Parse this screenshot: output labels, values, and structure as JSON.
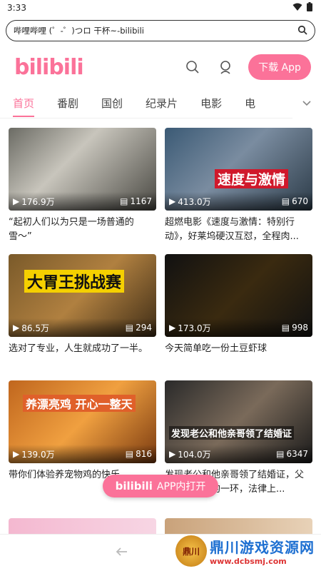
{
  "status": {
    "time": "3:33"
  },
  "url": {
    "text": "哔哩哔哩 (゜-゜)つロ 干杯~-bilibili"
  },
  "header": {
    "logo": "bilibili",
    "download_label": "下载 App"
  },
  "tabs": [
    {
      "label": "首页",
      "active": true
    },
    {
      "label": "番剧"
    },
    {
      "label": "国创"
    },
    {
      "label": "纪录片"
    },
    {
      "label": "电影"
    },
    {
      "label": "电"
    }
  ],
  "videos": [
    {
      "views": "176.9万",
      "danmaku": "1167",
      "title": "“起初人们以为只是一场普通的雪〜”",
      "caption": "",
      "bg": "linear-gradient(135deg,#6b6b64,#c8c5bc 40%,#4a4943)"
    },
    {
      "views": "413.0万",
      "danmaku": "670",
      "title": "超燃电影《速度与激情：特别行动》，好莱坞硬汉互怼，全程肉...",
      "caption": "速度与激情",
      "bg": "linear-gradient(135deg,#3b5a75,#7a8ca0 45%,#2c3b48)"
    },
    {
      "views": "86.5万",
      "danmaku": "294",
      "title": "选对了专业，人生就成功了一半。",
      "caption": "大胃王挑战赛",
      "bg": "linear-gradient(135deg,#7a5a2a,#b08040 50%,#3e2c16)"
    },
    {
      "views": "173.0万",
      "danmaku": "998",
      "title": "今天简单吃一份土豆虾球",
      "caption": "",
      "bg": "linear-gradient(135deg,#111,#3a2a10 50%,#111)"
    },
    {
      "views": "139.0万",
      "danmaku": "816",
      "title": "带你们体验养宠物鸡的快乐",
      "caption": "养漂亮鸡 开心一整天",
      "bg": "linear-gradient(135deg,#c0661e,#f0a040 50%,#7a3a10)"
    },
    {
      "views": "104.0万",
      "danmaku": "6347",
      "title": "发现老公和他亲哥领了结婚证，父亲也是其中的一环，法律上...",
      "caption": "发现老公和他亲哥领了结婚证",
      "bg": "linear-gradient(135deg,#2a2a2a,#7a6a5a 50%,#1a1a1a)"
    }
  ],
  "open_app": {
    "logo": "bilibili",
    "label": "APP内打开"
  },
  "watermark": {
    "badge": "鼎川",
    "name": "鼎川游戏资源网",
    "url": "www.dcbsmj.com"
  },
  "colors": {
    "accent": "#fb7299"
  }
}
